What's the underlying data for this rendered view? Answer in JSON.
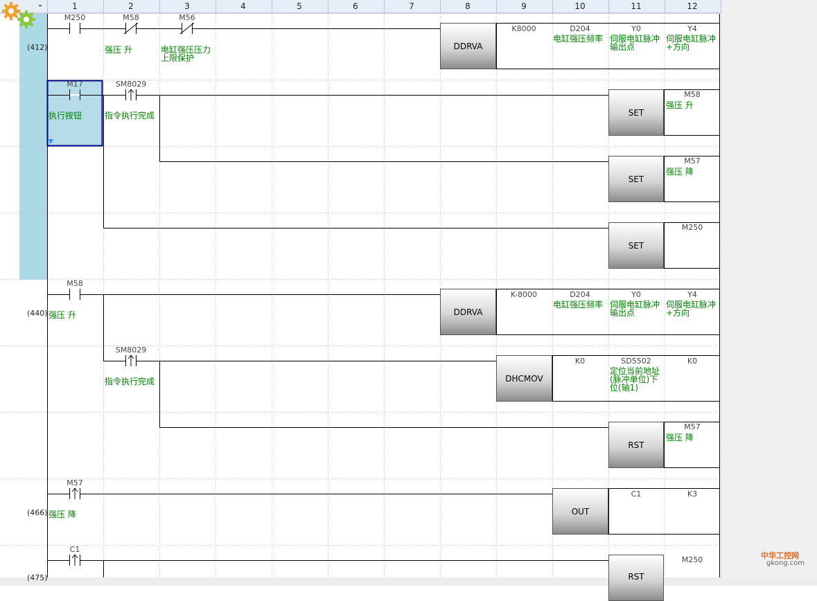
{
  "columns": [
    "1",
    "2",
    "3",
    "4",
    "5",
    "6",
    "7",
    "8",
    "9",
    "10",
    "11",
    "12"
  ],
  "rungs": [
    {
      "step": "(412)",
      "contacts": [
        {
          "device": "M250",
          "comment": ""
        },
        {
          "device": "M58",
          "comment": "强压 升"
        },
        {
          "device": "M56",
          "comment": "电缸强压压力上限保护"
        }
      ],
      "instr": "DDRVA",
      "params": [
        {
          "value": "K8000",
          "comment": ""
        },
        {
          "value": "D204",
          "comment": "电缸强压频率"
        },
        {
          "value": "Y0",
          "comment": "伺服电缸脉冲输出点"
        },
        {
          "value": "Y4",
          "comment": "伺服电缸脉冲+方向"
        }
      ]
    },
    {
      "contacts": [
        {
          "device": "M17",
          "comment": "执行按钮"
        },
        {
          "device": "SM8029",
          "comment": "指令执行完成"
        }
      ],
      "outputs": [
        {
          "instr": "SET",
          "device": "M58",
          "comment": "强压 升"
        },
        {
          "instr": "SET",
          "device": "M57",
          "comment": "强压 降"
        },
        {
          "instr": "SET",
          "device": "M250",
          "comment": ""
        }
      ]
    },
    {
      "step": "(440)",
      "contacts": [
        {
          "device": "M58",
          "comment": "强压 升"
        }
      ],
      "instr": "DDRVA",
      "params": [
        {
          "value": "K-8000",
          "comment": ""
        },
        {
          "value": "D204",
          "comment": "电缸强压频率"
        },
        {
          "value": "Y0",
          "comment": "伺服电缸脉冲输出点"
        },
        {
          "value": "Y4",
          "comment": "伺服电缸脉冲+方向"
        }
      ]
    },
    {
      "contacts": [
        {
          "device": "SM8029",
          "comment": "指令执行完成"
        }
      ],
      "instr": "DHCMOV",
      "params": [
        {
          "value": "K0",
          "comment": ""
        },
        {
          "value": "SD5502",
          "comment": "定位当前地址(脉冲单位)下位(轴1)"
        },
        {
          "value": "K0",
          "comment": ""
        }
      ],
      "outputs": [
        {
          "instr": "RST",
          "device": "M57",
          "comment": "强压 降"
        }
      ]
    },
    {
      "step": "(466)",
      "contacts": [
        {
          "device": "M57",
          "comment": "强压 降"
        }
      ],
      "instr": "OUT",
      "params": [
        {
          "value": "C1",
          "comment": ""
        },
        {
          "value": "K3",
          "comment": ""
        }
      ]
    },
    {
      "step": "(475)",
      "contacts": [
        {
          "device": "C1",
          "comment": ""
        }
      ],
      "outputs": [
        {
          "instr": "RST",
          "device": "M250",
          "comment": ""
        }
      ]
    }
  ],
  "watermark": {
    "name": "中华工控网",
    "site": "gkong.com"
  },
  "colors": {
    "selection": "#add8e6",
    "cursor": "#000080",
    "comment": "#008000",
    "header": "#e8eef7"
  }
}
